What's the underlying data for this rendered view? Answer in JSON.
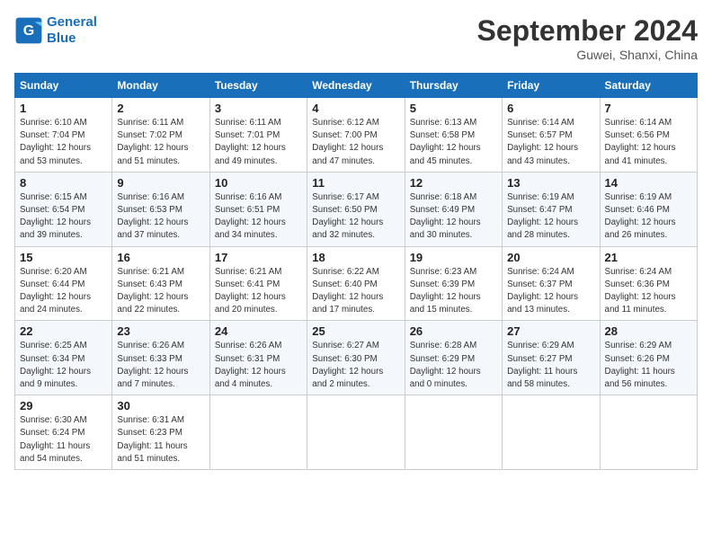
{
  "header": {
    "logo_line1": "General",
    "logo_line2": "Blue",
    "month_title": "September 2024",
    "location": "Guwei, Shanxi, China"
  },
  "days_of_week": [
    "Sunday",
    "Monday",
    "Tuesday",
    "Wednesday",
    "Thursday",
    "Friday",
    "Saturday"
  ],
  "weeks": [
    [
      {
        "day": "1",
        "info": "Sunrise: 6:10 AM\nSunset: 7:04 PM\nDaylight: 12 hours\nand 53 minutes."
      },
      {
        "day": "2",
        "info": "Sunrise: 6:11 AM\nSunset: 7:02 PM\nDaylight: 12 hours\nand 51 minutes."
      },
      {
        "day": "3",
        "info": "Sunrise: 6:11 AM\nSunset: 7:01 PM\nDaylight: 12 hours\nand 49 minutes."
      },
      {
        "day": "4",
        "info": "Sunrise: 6:12 AM\nSunset: 7:00 PM\nDaylight: 12 hours\nand 47 minutes."
      },
      {
        "day": "5",
        "info": "Sunrise: 6:13 AM\nSunset: 6:58 PM\nDaylight: 12 hours\nand 45 minutes."
      },
      {
        "day": "6",
        "info": "Sunrise: 6:14 AM\nSunset: 6:57 PM\nDaylight: 12 hours\nand 43 minutes."
      },
      {
        "day": "7",
        "info": "Sunrise: 6:14 AM\nSunset: 6:56 PM\nDaylight: 12 hours\nand 41 minutes."
      }
    ],
    [
      {
        "day": "8",
        "info": "Sunrise: 6:15 AM\nSunset: 6:54 PM\nDaylight: 12 hours\nand 39 minutes."
      },
      {
        "day": "9",
        "info": "Sunrise: 6:16 AM\nSunset: 6:53 PM\nDaylight: 12 hours\nand 37 minutes."
      },
      {
        "day": "10",
        "info": "Sunrise: 6:16 AM\nSunset: 6:51 PM\nDaylight: 12 hours\nand 34 minutes."
      },
      {
        "day": "11",
        "info": "Sunrise: 6:17 AM\nSunset: 6:50 PM\nDaylight: 12 hours\nand 32 minutes."
      },
      {
        "day": "12",
        "info": "Sunrise: 6:18 AM\nSunset: 6:49 PM\nDaylight: 12 hours\nand 30 minutes."
      },
      {
        "day": "13",
        "info": "Sunrise: 6:19 AM\nSunset: 6:47 PM\nDaylight: 12 hours\nand 28 minutes."
      },
      {
        "day": "14",
        "info": "Sunrise: 6:19 AM\nSunset: 6:46 PM\nDaylight: 12 hours\nand 26 minutes."
      }
    ],
    [
      {
        "day": "15",
        "info": "Sunrise: 6:20 AM\nSunset: 6:44 PM\nDaylight: 12 hours\nand 24 minutes."
      },
      {
        "day": "16",
        "info": "Sunrise: 6:21 AM\nSunset: 6:43 PM\nDaylight: 12 hours\nand 22 minutes."
      },
      {
        "day": "17",
        "info": "Sunrise: 6:21 AM\nSunset: 6:41 PM\nDaylight: 12 hours\nand 20 minutes."
      },
      {
        "day": "18",
        "info": "Sunrise: 6:22 AM\nSunset: 6:40 PM\nDaylight: 12 hours\nand 17 minutes."
      },
      {
        "day": "19",
        "info": "Sunrise: 6:23 AM\nSunset: 6:39 PM\nDaylight: 12 hours\nand 15 minutes."
      },
      {
        "day": "20",
        "info": "Sunrise: 6:24 AM\nSunset: 6:37 PM\nDaylight: 12 hours\nand 13 minutes."
      },
      {
        "day": "21",
        "info": "Sunrise: 6:24 AM\nSunset: 6:36 PM\nDaylight: 12 hours\nand 11 minutes."
      }
    ],
    [
      {
        "day": "22",
        "info": "Sunrise: 6:25 AM\nSunset: 6:34 PM\nDaylight: 12 hours\nand 9 minutes."
      },
      {
        "day": "23",
        "info": "Sunrise: 6:26 AM\nSunset: 6:33 PM\nDaylight: 12 hours\nand 7 minutes."
      },
      {
        "day": "24",
        "info": "Sunrise: 6:26 AM\nSunset: 6:31 PM\nDaylight: 12 hours\nand 4 minutes."
      },
      {
        "day": "25",
        "info": "Sunrise: 6:27 AM\nSunset: 6:30 PM\nDaylight: 12 hours\nand 2 minutes."
      },
      {
        "day": "26",
        "info": "Sunrise: 6:28 AM\nSunset: 6:29 PM\nDaylight: 12 hours\nand 0 minutes."
      },
      {
        "day": "27",
        "info": "Sunrise: 6:29 AM\nSunset: 6:27 PM\nDaylight: 11 hours\nand 58 minutes."
      },
      {
        "day": "28",
        "info": "Sunrise: 6:29 AM\nSunset: 6:26 PM\nDaylight: 11 hours\nand 56 minutes."
      }
    ],
    [
      {
        "day": "29",
        "info": "Sunrise: 6:30 AM\nSunset: 6:24 PM\nDaylight: 11 hours\nand 54 minutes."
      },
      {
        "day": "30",
        "info": "Sunrise: 6:31 AM\nSunset: 6:23 PM\nDaylight: 11 hours\nand 51 minutes."
      },
      {
        "day": "",
        "info": ""
      },
      {
        "day": "",
        "info": ""
      },
      {
        "day": "",
        "info": ""
      },
      {
        "day": "",
        "info": ""
      },
      {
        "day": "",
        "info": ""
      }
    ]
  ]
}
